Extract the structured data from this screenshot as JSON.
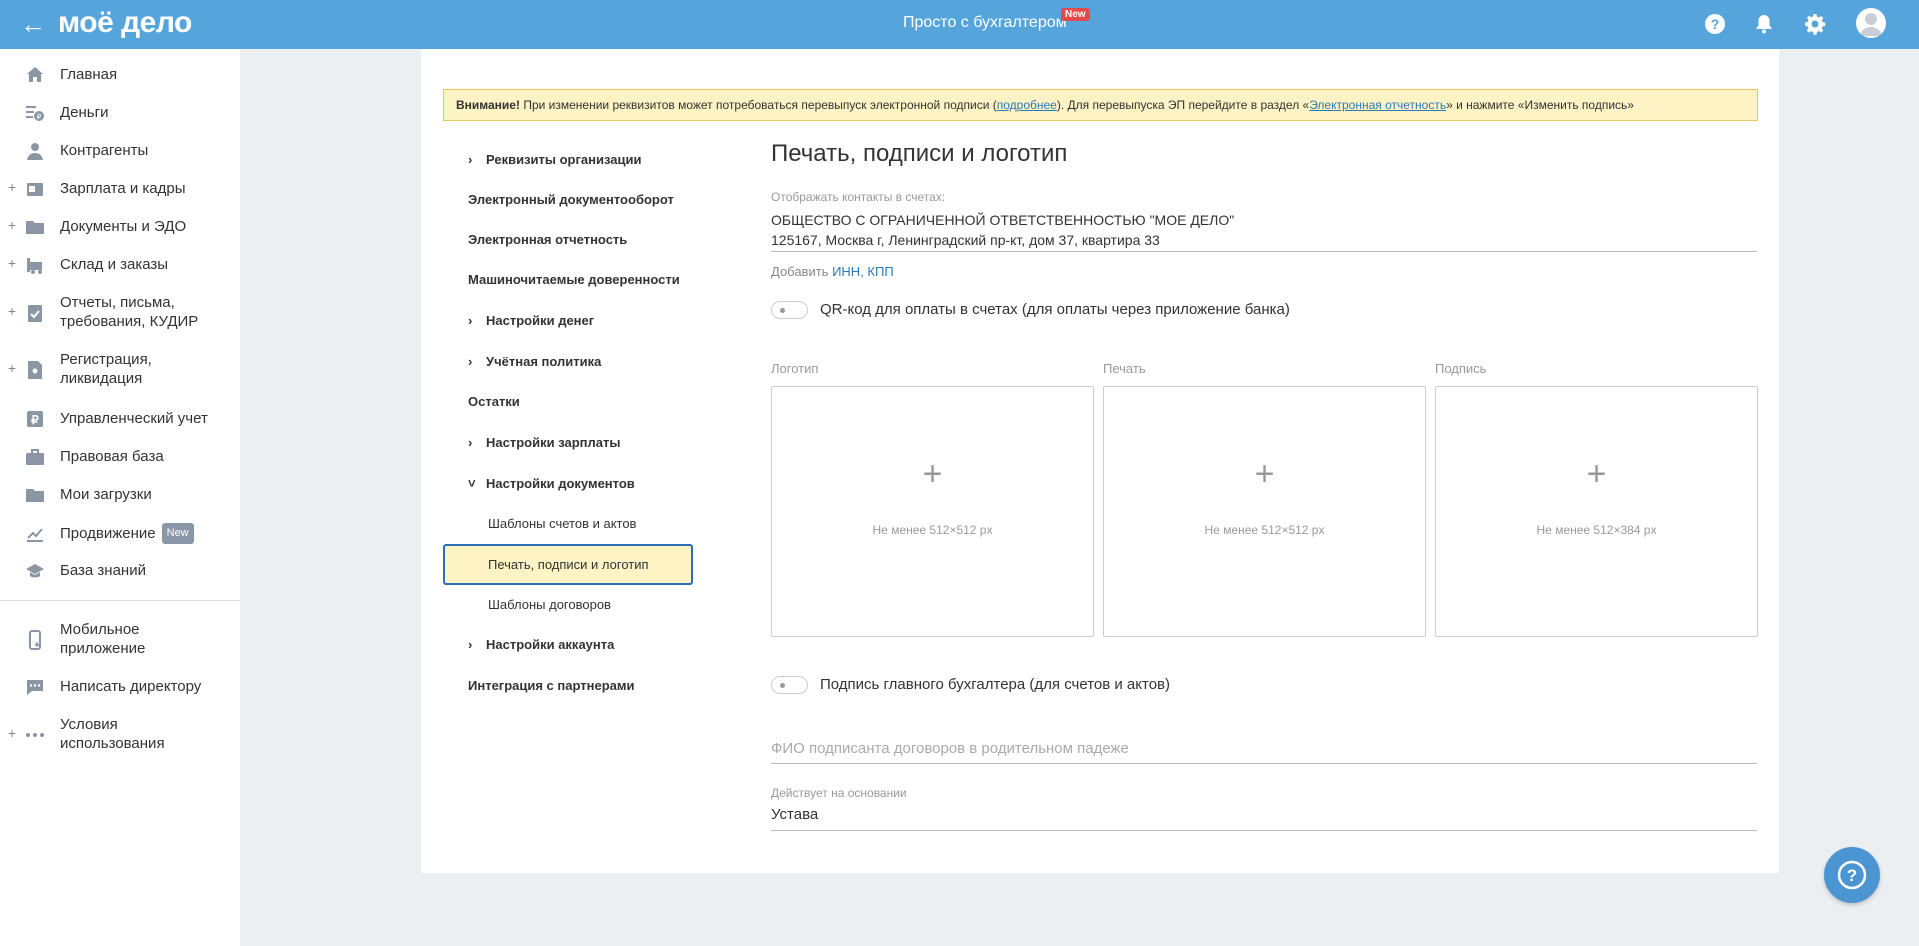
{
  "header": {
    "logo": "моё дело",
    "center_title": "Просто с бухгалтером",
    "new_badge": "New"
  },
  "sidebar": {
    "items": [
      {
        "label": "Главная",
        "icon": "home-icon",
        "plus": false
      },
      {
        "label": "Деньги",
        "icon": "money-icon",
        "plus": false
      },
      {
        "label": "Контрагенты",
        "icon": "contractors-icon",
        "plus": false
      },
      {
        "label": "Зарплата и кадры",
        "icon": "salary-icon",
        "plus": true
      },
      {
        "label": "Документы и ЭДО",
        "icon": "folder-icon",
        "plus": true
      },
      {
        "label": "Склад и заказы",
        "icon": "warehouse-icon",
        "plus": true
      },
      {
        "label": "Отчеты, письма, требования, КУДИР",
        "icon": "reports-icon",
        "plus": true
      },
      {
        "label": "Регистрация, ликвидация",
        "icon": "registration-icon",
        "plus": true
      },
      {
        "label": "Управленческий учет",
        "icon": "ruble-icon",
        "plus": false
      },
      {
        "label": "Правовая база",
        "icon": "briefcase-icon",
        "plus": false
      },
      {
        "label": "Мои загрузки",
        "icon": "downloads-folder-icon",
        "plus": false
      },
      {
        "label": "Продвижение",
        "icon": "promotion-icon",
        "plus": false,
        "badge": "New"
      },
      {
        "label": "База знаний",
        "icon": "graduation-cap-icon",
        "plus": false
      },
      {
        "label": "Мобильное приложение",
        "icon": "mobile-icon",
        "plus": false
      },
      {
        "label": "Написать директору",
        "icon": "chat-icon",
        "plus": false
      },
      {
        "label": "Условия использования",
        "icon": "more-dots-icon",
        "plus": true
      }
    ]
  },
  "warning": {
    "bold": "Внимание!",
    "text1": " При изменении реквизитов может потребоваться перевыпуск электронной подписи (",
    "link1": "подробнее",
    "text2": "). Для перевыпуска ЭП перейдите в раздел «",
    "link2": "Электронная отчетность",
    "text3": "» и нажмите «Изменить подпись»"
  },
  "settings_nav": {
    "items": [
      {
        "label": "Реквизиты организации",
        "chevron": "right"
      },
      {
        "label": "Электронный документооборот",
        "chevron": ""
      },
      {
        "label": "Электронная отчетность",
        "chevron": ""
      },
      {
        "label": "Машиночитаемые доверенности",
        "chevron": ""
      },
      {
        "label": "Настройки денег",
        "chevron": "right"
      },
      {
        "label": "Учётная политика",
        "chevron": "right"
      },
      {
        "label": "Остатки",
        "chevron": ""
      },
      {
        "label": "Настройки зарплаты",
        "chevron": "right"
      },
      {
        "label": "Настройки документов",
        "chevron": "down"
      },
      {
        "label": "Настройки аккаунта",
        "chevron": "right"
      },
      {
        "label": "Интеграция с партнерами",
        "chevron": ""
      }
    ],
    "sub_items": [
      "Шаблоны счетов и актов",
      "Печать, подписи и логотип",
      "Шаблоны договоров"
    ],
    "active": "Печать, подписи и логотип"
  },
  "content": {
    "title": "Печать, подписи и логотип",
    "contacts_label": "Отображать контакты в счетах:",
    "contacts_line1": "ОБЩЕСТВО С ОГРАНИЧЕННОЙ ОТВЕТСТВЕННОСТЬЮ \"МОЕ ДЕЛО\"",
    "contacts_line2": "125167, Москва г, Ленинградский пр-кт, дом 37, квартира 33",
    "add_prefix": "Добавить ",
    "add_link": "ИНН, КПП",
    "qr_toggle_label": "QR-код для оплаты в счетах (для оплаты через приложение банка)",
    "qr_toggle_on": false,
    "uploads": [
      {
        "label": "Логотип",
        "hint": "Не менее 512×512 px"
      },
      {
        "label": "Печать",
        "hint": "Не менее 512×512 px"
      },
      {
        "label": "Подпись",
        "hint": "Не менее 512×384 px"
      }
    ],
    "upload_plus": "+",
    "chief_toggle_label": "Подпись главного бухгалтера (для счетов и актов)",
    "chief_toggle_on": false,
    "signer_placeholder": "ФИО подписанта договоров в родительном падеже",
    "basis_label": "Действует на основании",
    "basis_value": "Устава"
  },
  "colors": {
    "header_bg": "#55a5dc",
    "warning_bg": "#fdf3c4",
    "active_border": "#2a6fb5",
    "badge_red": "#e54a4a",
    "link": "#2a7ab5"
  }
}
